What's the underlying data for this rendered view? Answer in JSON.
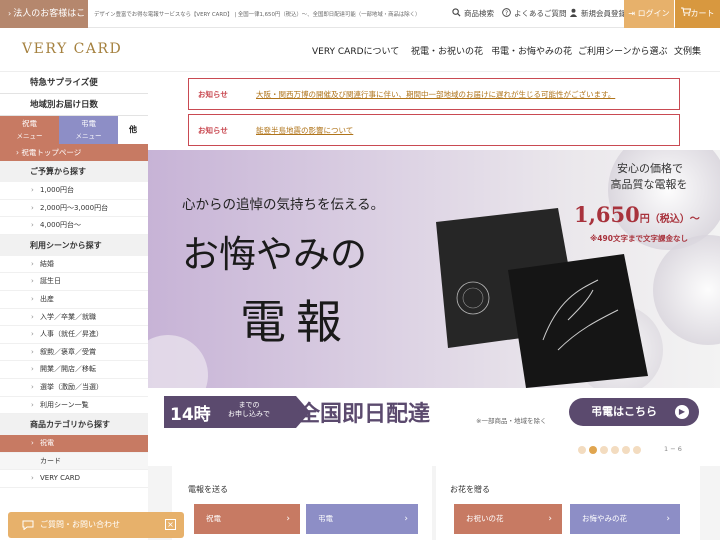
{
  "topbar": {
    "corporate_link": "法人のお客様はこちら",
    "tagline": "デザイン豊富でお得な電報サービスなら【VERY CARD】 | 全国一律1,650円（税込）〜、全国即日配達可能（一部地域・商品は除く）",
    "search": "商品検索",
    "faq": "よくあるご質問",
    "register": "新規会員登録",
    "login": "ログイン",
    "cart": "カート"
  },
  "header": {
    "logo": "VERY CARD",
    "nav": [
      "VERY CARDについて",
      "祝電・お祝いの花",
      "弔電・お悔やみの花",
      "ご利用シーンから選ぶ",
      "文例集"
    ]
  },
  "sidebar": {
    "special": "特急サプライズ便",
    "regional": "地域別お届け日数",
    "tabs": [
      {
        "label": "祝電",
        "sub": "メニュー"
      },
      {
        "label": "弔電",
        "sub": "メニュー"
      },
      {
        "label": "他",
        "sub": ""
      }
    ],
    "top_link": "祝電トップページ",
    "budget_heading": "ご予算から探す",
    "budget_items": [
      "1,000円台",
      "2,000円〜3,000円台",
      "4,000円台〜"
    ],
    "scene_heading": "利用シーンから探す",
    "scene_items": [
      "結婚",
      "誕生日",
      "出産",
      "入学／卒業／就職",
      "人事（就任／昇進）",
      "叙勲／褒章／受賞",
      "開業／開店／移転",
      "選挙（激励／当選）",
      "利用シーン一覧"
    ],
    "category_heading": "商品カテゴリから探す",
    "category_items": [
      "祝電",
      "カード",
      "VERY CARD"
    ]
  },
  "notices": [
    {
      "label": "お知らせ",
      "text": "大阪・関西万博の開催及び関連行事に伴い、期間中一部地域のお届けに遅れが生じる可能性がございます。"
    },
    {
      "label": "お知らせ",
      "text": "能登半島地震の影響について"
    }
  ],
  "hero": {
    "catch": "心からの追悼の気持ちを伝える。",
    "title_line1": "お悔やみの",
    "title_line2": "電報",
    "price_lead1": "安心の価格で",
    "price_lead2": "高品質な電報を",
    "price_value": "1,650",
    "price_unit": "円（税込）〜",
    "price_note": "※490文字まで文字課金なし"
  },
  "banner": {
    "hours": "14時",
    "hours_sub1": "までの",
    "hours_sub2": "お申し込みで",
    "headline": "全国即日配達",
    "note": "※一部商品・地域を除く",
    "button": "弔電はこちら"
  },
  "carousel": {
    "active_index": 1,
    "dot_count": 6,
    "pager": "1 − 6"
  },
  "bottom": {
    "send_heading": "電報を送る",
    "send_buttons": [
      "祝電",
      "弔電"
    ],
    "flower_heading": "お花を贈る",
    "flower_buttons": [
      "お祝いの花",
      "お悔やみの花"
    ]
  },
  "contact": "ご質問・お問い合わせ",
  "colors": {
    "corporate": "#b5876d",
    "login": "#e7b16b",
    "cart": "#d8983f",
    "celebration": "#c77a63",
    "condolence": "#8d8ec6",
    "notice": "#c94a52",
    "banner_button": "#5b4a6e"
  }
}
